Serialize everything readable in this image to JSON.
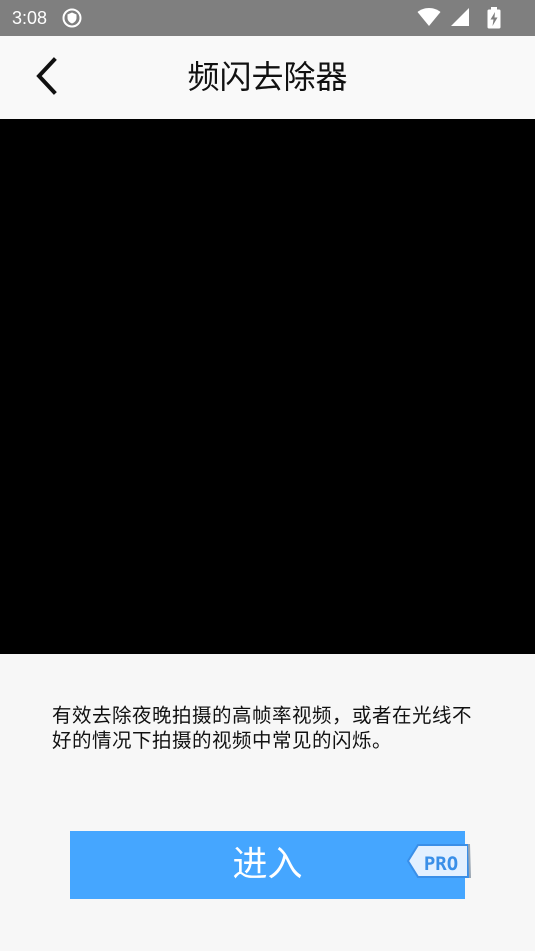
{
  "status_bar": {
    "time": "3:08",
    "icons": [
      "shield-icon",
      "wifi-icon",
      "signal-icon",
      "battery-charging-icon"
    ]
  },
  "app_bar": {
    "back_icon": "chevron-left-icon",
    "title": "频闪去除器"
  },
  "preview": {
    "color": "#000000"
  },
  "description": {
    "text": "有效去除夜晚拍摄的高帧率视频，或者在光线不好的情况下拍摄的视频中常见的闪烁。"
  },
  "enter_button": {
    "label": "进入",
    "color": "#45a6ff",
    "badge": "PRO"
  }
}
